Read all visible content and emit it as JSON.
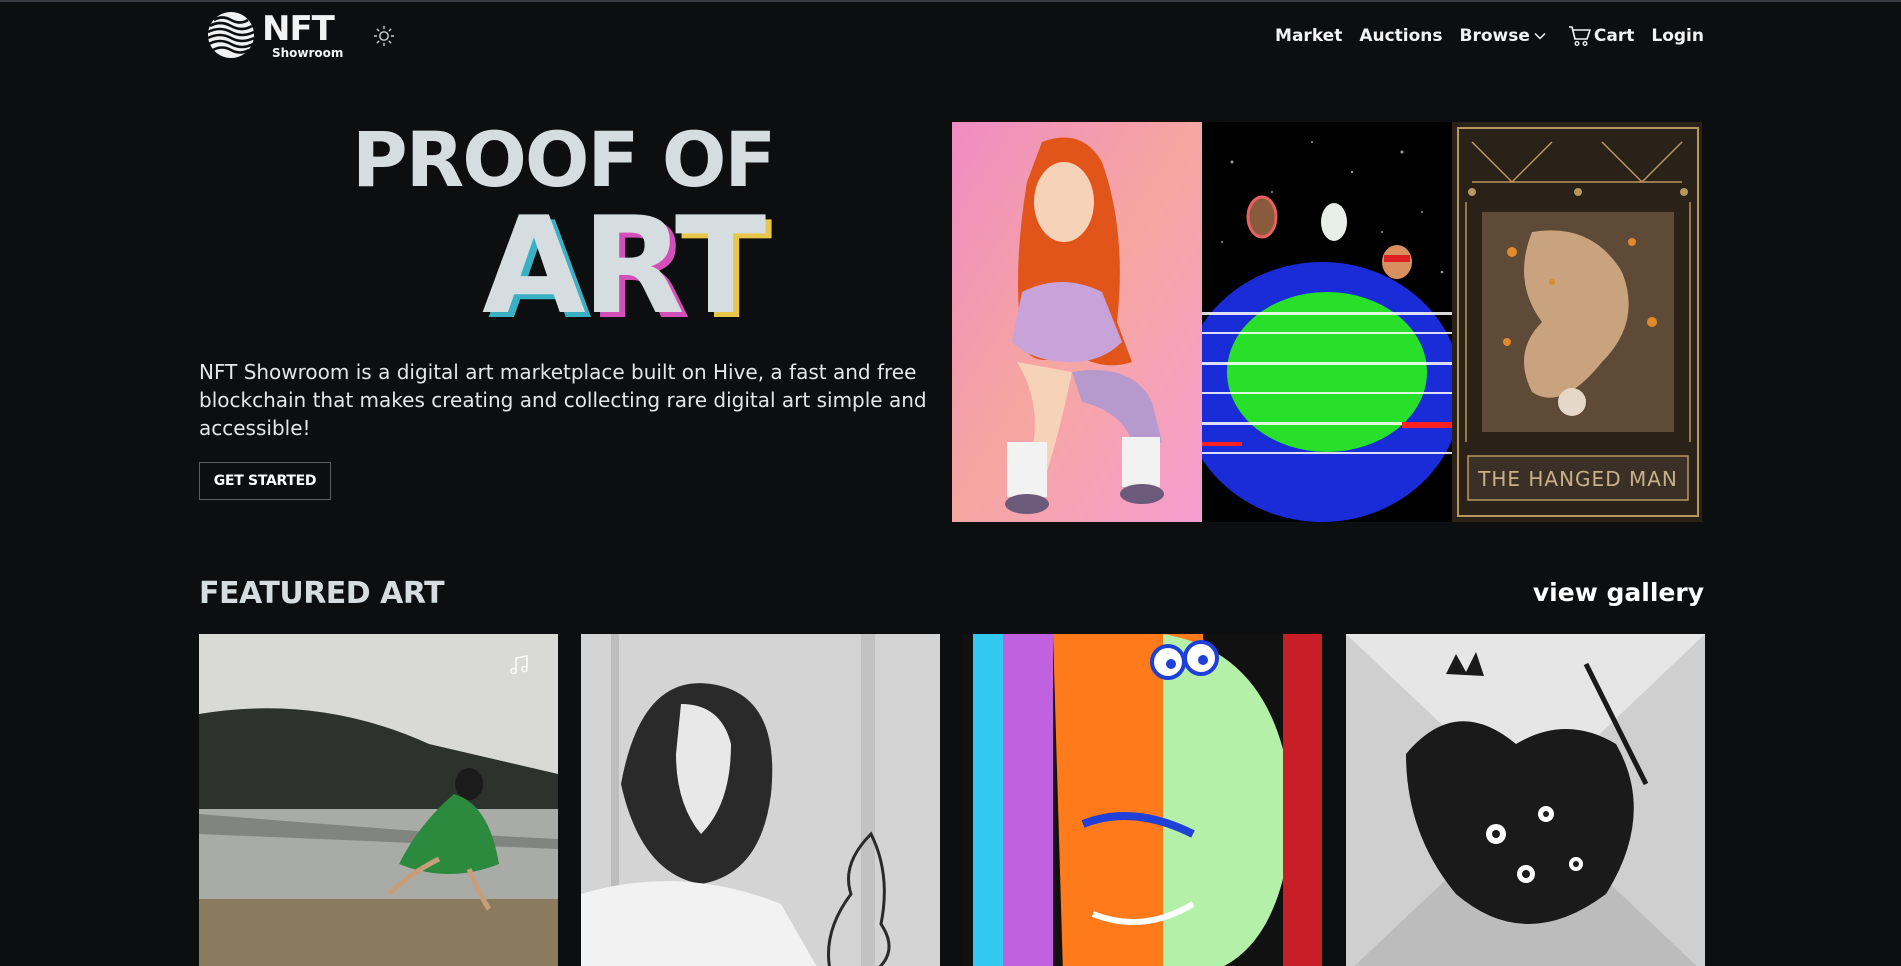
{
  "brand": {
    "logo_title": "NFT",
    "logo_subtitle": "Showroom",
    "globe_icon": "globe-logo-icon",
    "theme_icon": "sun-icon"
  },
  "nav": {
    "items": [
      {
        "label": "Market"
      },
      {
        "label": "Auctions"
      },
      {
        "label": "Browse",
        "icon": "chevron-down-icon"
      },
      {
        "label": "Cart",
        "icon": "cart-icon"
      },
      {
        "label": "Login"
      }
    ]
  },
  "hero": {
    "title_line1": "PROOF OF",
    "title_line2_letters": [
      "A",
      "R",
      "T"
    ],
    "description": "NFT Showroom is a digital art marketplace built on Hive, a fast and free blockchain that makes creating and collecting rare digital art simple and accessible!",
    "cta_label": "GET STARTED",
    "images": [
      {
        "name": "red-haired-girl-artwork"
      },
      {
        "name": "glitch-planet-artwork"
      },
      {
        "name": "hanged-man-tarot-artwork",
        "caption": "THE HANGED MAN"
      }
    ]
  },
  "featured": {
    "title": "FEATURED ART",
    "view_all_label": "view gallery",
    "cards": [
      {
        "name": "dancer-by-lake-artwork",
        "icon": "music-note-icon"
      },
      {
        "name": "old-man-ink-artwork"
      },
      {
        "name": "colorful-monster-artwork"
      },
      {
        "name": "wolves-engraving-artwork"
      }
    ]
  },
  "colors": {
    "background": "#0d0e10",
    "title_text": "#d5dde0",
    "accent_cyan": "#3ab0c4",
    "accent_magenta": "#d14fb6",
    "accent_yellow": "#e8c64a"
  }
}
